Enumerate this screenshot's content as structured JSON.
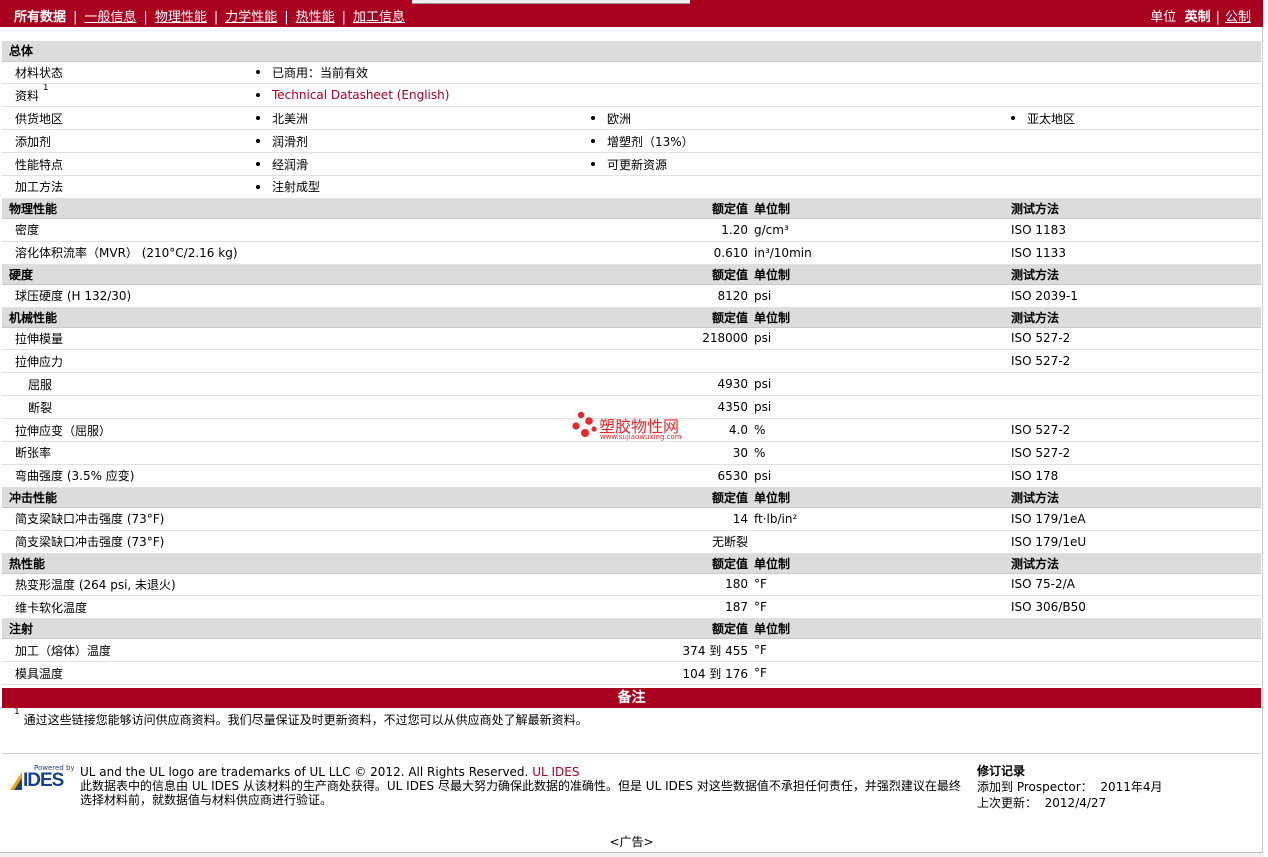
{
  "topbar": {
    "tabs": [
      {
        "label": "所有数据",
        "active": true
      },
      {
        "label": "一般信息",
        "active": false
      },
      {
        "label": "物理性能",
        "active": false
      },
      {
        "label": "力学性能",
        "active": false
      },
      {
        "label": "热性能",
        "active": false
      },
      {
        "label": "加工信息",
        "active": false
      }
    ],
    "units_label": "单位",
    "unit_english": "英制",
    "unit_metric": "公制"
  },
  "overview": {
    "title": "总体",
    "material_status": {
      "label": "材料状态",
      "value": "已商用：当前有效"
    },
    "sources": {
      "label": "资料",
      "sup": "1",
      "link": "Technical Datasheet (English)"
    },
    "supply": {
      "label": "供货地区",
      "values": [
        "北美洲",
        "欧洲",
        "亚太地区"
      ]
    },
    "additives": {
      "label": "添加剂",
      "values": [
        "润滑剂",
        "增塑剂（13%）"
      ]
    },
    "features": {
      "label": "性能特点",
      "values": [
        "经润滑",
        "可更新资源"
      ]
    },
    "processing": {
      "label": "加工方法",
      "values": [
        "注射成型"
      ]
    }
  },
  "headers": {
    "value": "额定值",
    "unit": "单位制",
    "method": "测试方法"
  },
  "physical": {
    "title": "物理性能",
    "rows": [
      {
        "label": "密度",
        "value": "1.20",
        "unit": "g/cm³",
        "method": "ISO 1183"
      },
      {
        "label": "溶化体积流率（MVR） (210°C/2.16 kg)",
        "value": "0.610",
        "unit": "in³/10min",
        "method": "ISO 1133"
      }
    ]
  },
  "hardness": {
    "title": "硬度",
    "rows": [
      {
        "label": "球压硬度 (H 132/30)",
        "value": "8120",
        "unit": "psi",
        "method": "ISO 2039-1"
      }
    ]
  },
  "mechanical": {
    "title": "机械性能",
    "rows": [
      {
        "label": "拉伸模量",
        "value": "218000",
        "unit": "psi",
        "method": "ISO 527-2"
      },
      {
        "label": "拉伸应力",
        "value": "",
        "unit": "",
        "method": "ISO 527-2"
      },
      {
        "label": "屈服",
        "value": "4930",
        "unit": "psi",
        "method": ""
      },
      {
        "label": "断裂",
        "value": "4350",
        "unit": "psi",
        "method": ""
      },
      {
        "label": "拉伸应变（屈服）",
        "value": "4.0",
        "unit": "%",
        "method": "ISO 527-2"
      },
      {
        "label": "断张率",
        "value": "30",
        "unit": "%",
        "method": "ISO 527-2"
      },
      {
        "label": "弯曲强度 (3.5% 应变)",
        "value": "6530",
        "unit": "psi",
        "method": "ISO 178"
      }
    ]
  },
  "impact": {
    "title": "冲击性能",
    "rows": [
      {
        "label": "简支梁缺口冲击强度 (73°F)",
        "value": "14",
        "unit": "ft·lb/in²",
        "method": "ISO 179/1eA"
      },
      {
        "label": "简支梁缺口冲击强度 (73°F)",
        "value": "无断裂",
        "unit": "",
        "method": "ISO 179/1eU"
      }
    ]
  },
  "thermal": {
    "title": "热性能",
    "rows": [
      {
        "label": "热变形温度 (264 psi, 未退火)",
        "value": "180",
        "unit": "°F",
        "method": "ISO 75-2/A"
      },
      {
        "label": "维卡软化温度",
        "value": "187",
        "unit": "°F",
        "method": "ISO 306/B50"
      }
    ]
  },
  "injection": {
    "title": "注射",
    "rows": [
      {
        "label": "加工（熔体）温度",
        "value": "374 到 455",
        "unit": "°F",
        "method": ""
      },
      {
        "label": "模具温度",
        "value": "104 到 176",
        "unit": "°F",
        "method": ""
      }
    ]
  },
  "notes": {
    "title": "备注",
    "sup": "1",
    "text": "通过这些链接您能够访问供应商资料。我们尽量保证及时更新资料，不过您可以从供应商处了解最新资料。"
  },
  "footer": {
    "logo_small": "Powered by",
    "logo_big": "IDES",
    "line1": "UL and the UL logo are trademarks of UL LLC © 2012. All Rights Reserved.",
    "line1_link": "UL IDES",
    "line2": "此数据表中的信息由 UL IDES 从该材料的生产商处获得。UL IDES 尽最大努力确保此数据的准确性。但是 UL IDES 对这些数据值不承担任何责任，并强烈建议在最终选择材料前，就数据值与材料供应商进行验证。",
    "revision_title": "修订记录",
    "added_label": "添加到 Prospector：",
    "added_value": "2011年4月",
    "updated_label": "上次更新：",
    "updated_value": "2012/4/27"
  },
  "ad": "<广告>",
  "watermark": {
    "text": "塑胶物性网",
    "url": "www.sujiaowuxing.com"
  },
  "colors": {
    "brand": "#a8001e",
    "section_bg": "#dcdcdc"
  }
}
